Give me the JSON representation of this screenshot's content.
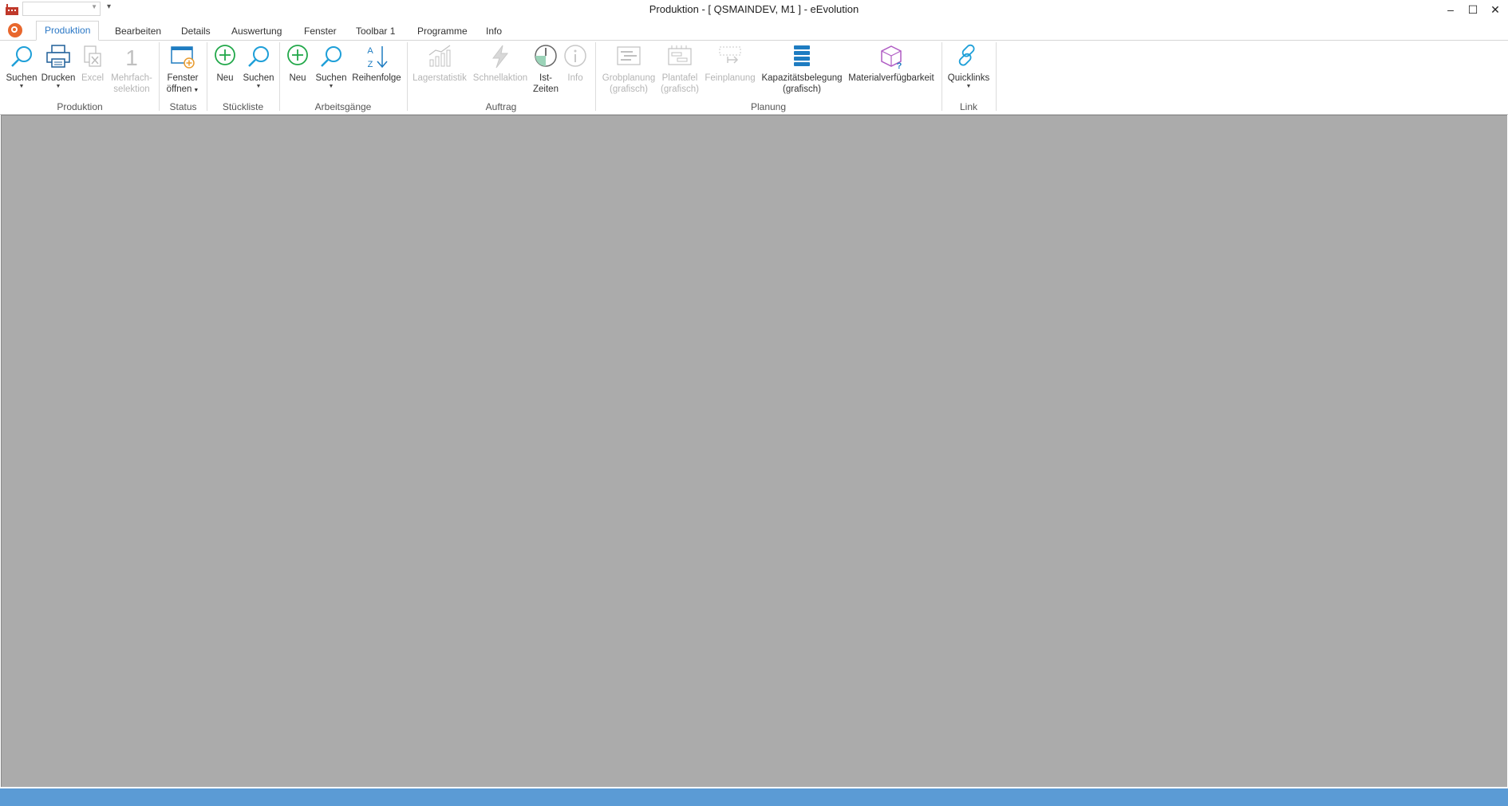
{
  "window": {
    "title": "Produktion - [ QSMAINDEV, M1 ]  -  eEvolution",
    "combo_value": ""
  },
  "tabs": [
    {
      "label": "Produktion",
      "active": true
    },
    {
      "label": "Bearbeiten"
    },
    {
      "label": "Details"
    },
    {
      "label": "Auswertung"
    },
    {
      "label": "Fenster"
    },
    {
      "label": "Toolbar 1"
    },
    {
      "label": "Programme"
    },
    {
      "label": "Info"
    }
  ],
  "ribbon": {
    "groups": {
      "produktion": "Produktion",
      "status": "Status",
      "stueckliste": "Stückliste",
      "arbeitsgaenge": "Arbeitsgänge",
      "auftrag": "Auftrag",
      "planung": "Planung",
      "link": "Link"
    },
    "buttons": {
      "suchen": {
        "line1": "Suchen"
      },
      "drucken": {
        "line1": "Drucken"
      },
      "excel": {
        "line1": "Excel"
      },
      "mehrfach": {
        "line1": "Mehrfach-",
        "line2": "selektion"
      },
      "fenster": {
        "line1": "Fenster",
        "line2": "öffnen"
      },
      "sl_neu": {
        "line1": "Neu"
      },
      "sl_suchen": {
        "line1": "Suchen"
      },
      "ag_neu": {
        "line1": "Neu"
      },
      "ag_suchen": {
        "line1": "Suchen"
      },
      "reihenfolge": {
        "line1": "Reihenfolge"
      },
      "lagerstatistik": {
        "line1": "Lagerstatistik"
      },
      "schnellaktion": {
        "line1": "Schnellaktion"
      },
      "istzeiten": {
        "line1": "Ist-",
        "line2": "Zeiten"
      },
      "info": {
        "line1": "Info"
      },
      "grobplanung": {
        "line1": "Grobplanung",
        "line2": "(grafisch)"
      },
      "plantafel": {
        "line1": "Plantafel",
        "line2": "(grafisch)"
      },
      "feinplanung": {
        "line1": "Feinplanung"
      },
      "kapazitaet": {
        "line1": "Kapazitätsbelegung",
        "line2": "(grafisch)"
      },
      "material": {
        "line1": "Materialverfügbarkeit"
      },
      "quicklinks": {
        "line1": "Quicklinks"
      }
    }
  },
  "colors": {
    "accent": "#2b78c6",
    "workspace": "#ababab",
    "statusbar": "#5b9bd5",
    "app_icon": "#e8672d"
  }
}
